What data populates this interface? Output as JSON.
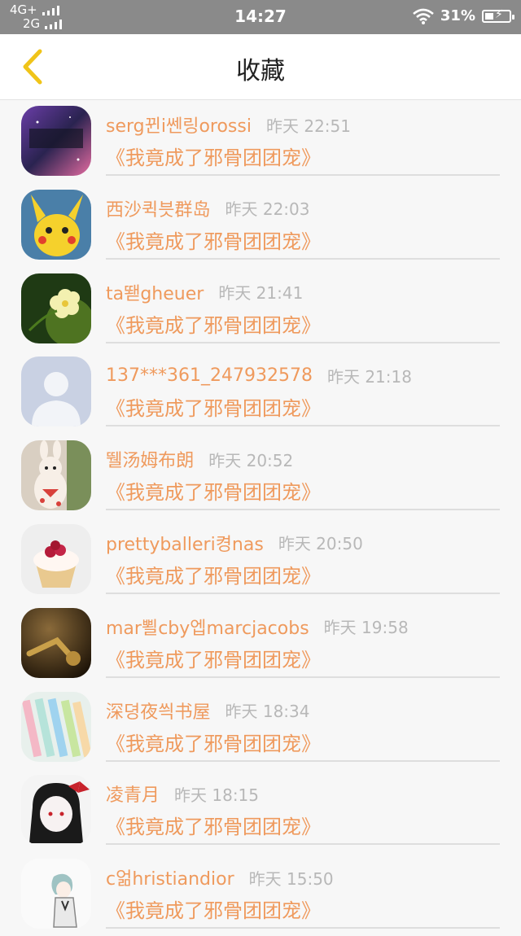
{
  "status_bar": {
    "network_top": "4G+",
    "network_bottom": "2G",
    "time": "14:27",
    "battery": "31%"
  },
  "nav": {
    "title": "收藏"
  },
  "favorites": [
    {
      "user": "serg뀐i쎈링orossi",
      "time": "昨天 22:51",
      "book": "《我竟成了邪骨团团宠》"
    },
    {
      "user": "西沙퀵븟群岛",
      "time": "昨天 22:03",
      "book": "《我竟成了邪骨团团宠》"
    },
    {
      "user": "ta뙏gheuer",
      "time": "昨天 21:41",
      "book": "《我竟成了邪骨团团宠》"
    },
    {
      "user": "137***361_247932578",
      "time": "昨天 21:18",
      "book": "《我竟成了邪骨团团宠》"
    },
    {
      "user": "뛜汤姆布朗",
      "time": "昨天 20:52",
      "book": "《我竟成了邪骨团团宠》"
    },
    {
      "user": "prettyballeri켱nas",
      "time": "昨天 20:50",
      "book": "《我竟成了邪骨团团宠》"
    },
    {
      "user": "mar뾜cby엡marcjacobs",
      "time": "昨天 19:58",
      "book": "《我竟成了邪骨团团宠》"
    },
    {
      "user": "深뎡夜씍书屋",
      "time": "昨天 18:34",
      "book": "《我竟成了邪骨团团宠》"
    },
    {
      "user": "凌青月",
      "time": "昨天 18:15",
      "book": "《我竟成了邪骨团团宠》"
    },
    {
      "user": "c얾hristiandior",
      "time": "昨天 15:50",
      "book": "《我竟成了邪骨团团宠》"
    }
  ],
  "colors": {
    "accent": "#ef9a5d",
    "back_arrow": "#f0c419",
    "muted": "#b8b8b8"
  }
}
